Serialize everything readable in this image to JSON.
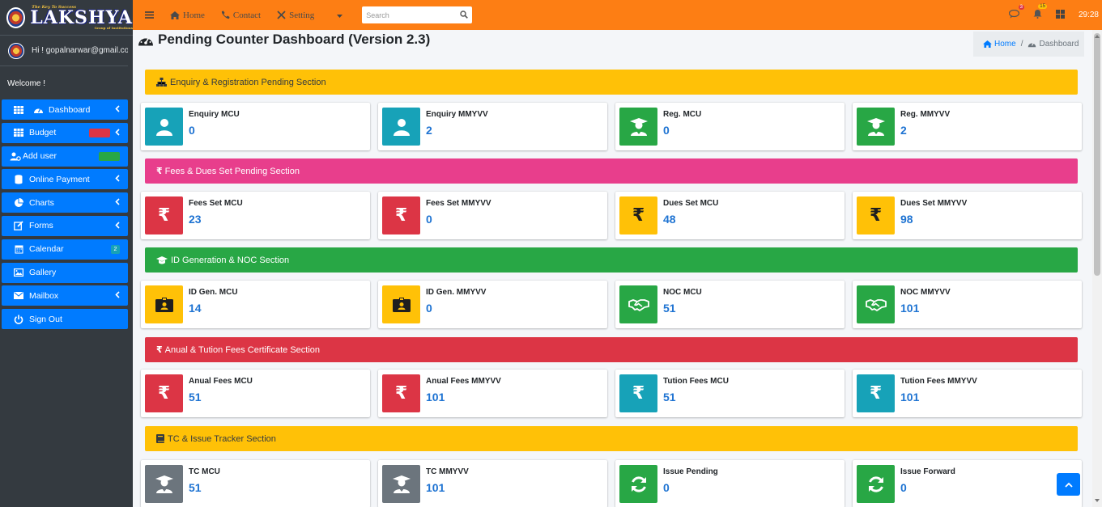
{
  "brand": {
    "name": "LAKSHYA",
    "tagline": "The Key To Success",
    "sub": "Group of Institutions"
  },
  "user": {
    "greeting": "Hi ! gopalnarwar@gmail.com",
    "welcome": "Welcome !"
  },
  "sidebar": {
    "items": [
      {
        "label": "Dashboard",
        "icon": "dashboard-icon"
      },
      {
        "label": "Budget",
        "icon": "table-icon"
      },
      {
        "label": "Add user",
        "icon": "user-cog-icon"
      },
      {
        "label": "Online Payment",
        "icon": "database-icon"
      },
      {
        "label": "Charts",
        "icon": "pie-chart-icon"
      },
      {
        "label": "Forms",
        "icon": "edit-icon"
      },
      {
        "label": "Calendar",
        "icon": "calendar-icon",
        "badge": "2"
      },
      {
        "label": "Gallery",
        "icon": "image-icon"
      },
      {
        "label": "Mailbox",
        "icon": "envelope-icon"
      },
      {
        "label": "Sign Out",
        "icon": "power-icon"
      }
    ]
  },
  "topnav": {
    "home": "Home",
    "contact": "Contact",
    "setting": "Setting",
    "search_placeholder": "Search",
    "messages_badge": "3",
    "notifications_badge": "15",
    "time": "29:28"
  },
  "page": {
    "title": "Pending Counter Dashboard (Version 2.3)",
    "breadcrumb_home": "Home",
    "breadcrumb_current": "Dashboard"
  },
  "sections": [
    {
      "title": "Enquiry & Registration Pending Section",
      "cards": [
        {
          "label": "Enquiry MCU",
          "value": "0"
        },
        {
          "label": "Enquiry MMYVV",
          "value": "2"
        },
        {
          "label": "Reg. MCU",
          "value": "0"
        },
        {
          "label": "Reg. MMYVV",
          "value": "2"
        }
      ]
    },
    {
      "title": "Fees & Dues Set Pending Section",
      "cards": [
        {
          "label": "Fees Set MCU",
          "value": "23"
        },
        {
          "label": "Fees Set MMYVV",
          "value": "0"
        },
        {
          "label": "Dues Set MCU",
          "value": "48"
        },
        {
          "label": "Dues Set MMYVV",
          "value": "98"
        }
      ]
    },
    {
      "title": "ID Generation & NOC Section",
      "cards": [
        {
          "label": "ID Gen. MCU",
          "value": "14"
        },
        {
          "label": "ID Gen. MMYVV",
          "value": "0"
        },
        {
          "label": "NOC MCU",
          "value": "51"
        },
        {
          "label": "NOC MMYVV",
          "value": "101"
        }
      ]
    },
    {
      "title": "Anual & Tution Fees Certificate Section",
      "cards": [
        {
          "label": "Anual Fees MCU",
          "value": "51"
        },
        {
          "label": "Anual Fees MMYVV",
          "value": "101"
        },
        {
          "label": "Tution Fees MCU",
          "value": "51"
        },
        {
          "label": "Tution Fees MMYVV",
          "value": "101"
        }
      ]
    },
    {
      "title": "TC & Issue Tracker Section",
      "cards": [
        {
          "label": "TC MCU",
          "value": "51"
        },
        {
          "label": "TC MMYVV",
          "value": "101"
        },
        {
          "label": "Issue Pending",
          "value": "0"
        },
        {
          "label": "Issue Forward",
          "value": "0"
        }
      ]
    }
  ],
  "colors": {
    "topnav": "#fd7e14",
    "sidebar": "#343a40",
    "menu": "#007bff",
    "value": "#1e73d2"
  }
}
